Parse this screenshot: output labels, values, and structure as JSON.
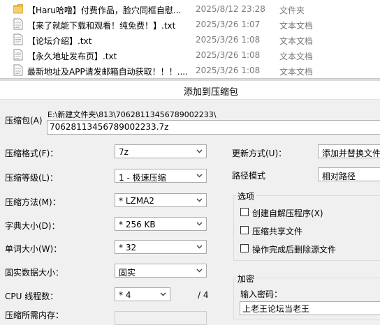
{
  "file_list": {
    "rows": [
      {
        "icon": "folder-icon",
        "name": "【Haru哈噜】付费作品，脸穴同框自慰...",
        "date": "2025/8/12 23:28",
        "type": "文件夹"
      },
      {
        "icon": "text-file-icon",
        "name": "【来了就能下载和观看！纯免费！】.txt",
        "date": "2025/3/26 1:07",
        "type": "文本文档"
      },
      {
        "icon": "text-file-icon",
        "name": "【论坛介绍】.txt",
        "date": "2025/3/26 1:08",
        "type": "文本文档"
      },
      {
        "icon": "text-file-icon",
        "name": "【永久地址发布页】.txt",
        "date": "2025/3/26 1:08",
        "type": "文本文档"
      },
      {
        "icon": "text-file-icon",
        "name": "最新地址及APP请发邮箱自动获取！！！....",
        "date": "2025/3/26 1:08",
        "type": "文本文档"
      }
    ]
  },
  "dialog": {
    "title": "添加到压缩包",
    "archive_label": "压缩包(A)",
    "archive_path": "E:\\新建文件夹\\813\\70628113456789002233\\",
    "archive_name": "70628113456789002233.7z",
    "format_label": "压缩格式(F)：",
    "format_value": "7z",
    "level_label": "压缩等级(L)：",
    "level_value": "1 - 极速压缩",
    "method_label": "压缩方法(M)：",
    "method_value": "* LZMA2",
    "dict_label": "字典大小(D)：",
    "dict_value": "* 256 KB",
    "word_label": "单词大小(W)：",
    "word_value": "* 32",
    "solid_label": "固实数据大小：",
    "solid_value": "固实",
    "threads_label": "CPU 线程数：",
    "threads_value": "* 4",
    "threads_total": "/ 4",
    "memory_label": "压缩所需内存：",
    "update_label": "更新方式(U)：",
    "update_value": "添加并替换文件",
    "path_mode_label": "路径模式",
    "path_mode_value": "相对路径",
    "options_title": "选项",
    "options": [
      {
        "label": "创建自解压程序(X)",
        "checked": false
      },
      {
        "label": "压缩共享文件",
        "checked": false
      },
      {
        "label": "操作完成后删除源文件",
        "checked": false
      }
    ],
    "encryption_title": "加密",
    "password_label": "输入密码：",
    "password_value": "上老王论坛当老王"
  },
  "colors": {
    "folder": "#e8b84a",
    "border": "#ababab"
  }
}
